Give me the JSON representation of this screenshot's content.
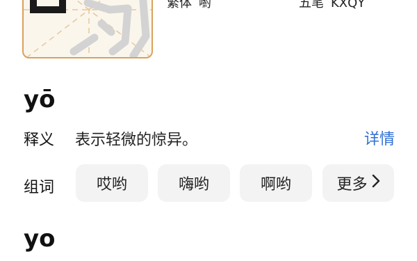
{
  "char_card": {
    "glyph": "哟",
    "info": {
      "style_label": "繁体",
      "style_value": "喲",
      "wubi_label": "五笔",
      "wubi_value": "KXQY"
    }
  },
  "readings": [
    {
      "pinyin": "yō",
      "meaning_label": "释义",
      "meaning": "表示轻微的惊异。",
      "detail_link": "详情",
      "words_label": "组词",
      "words": [
        "哎哟",
        "嗨哟",
        "啊哟"
      ],
      "more_label": "更多"
    },
    {
      "pinyin": "yo"
    }
  ],
  "colors": {
    "accent_link": "#2f6fd6",
    "card_border": "#d9a25a",
    "card_bg": "#fbf6ec",
    "chip_bg": "#f3f3f3"
  },
  "icons": {
    "more": "chevron-right-icon"
  }
}
